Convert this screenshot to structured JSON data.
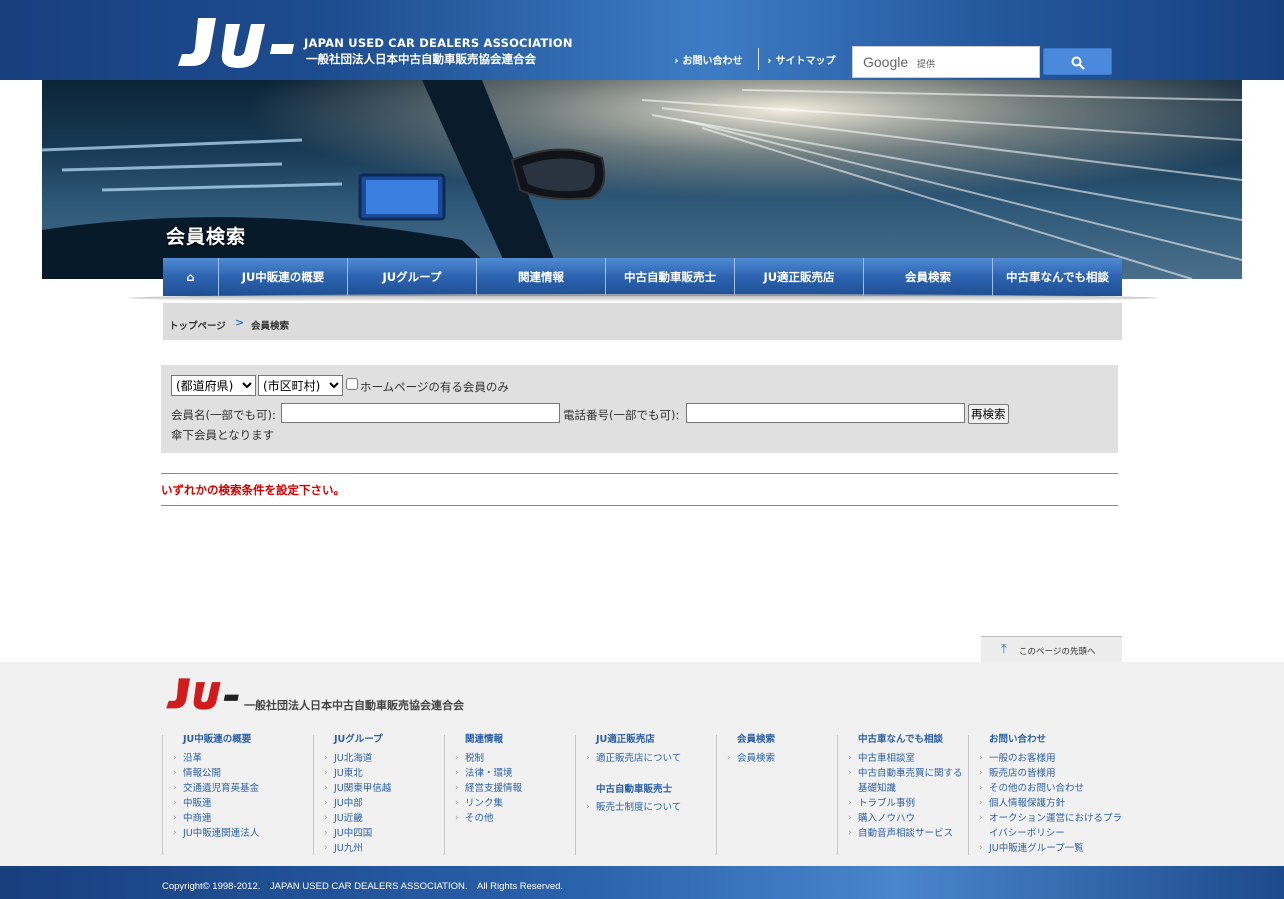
{
  "header": {
    "logo_text": "JU",
    "org_name_en": "JAPAN USED CAR DEALERS ASSOCIATION",
    "org_name_ja": "一般社団法人日本中古自動車販売協会連合会",
    "links": [
      {
        "label": "お問い合わせ"
      },
      {
        "label": "サイトマップ"
      }
    ],
    "search": {
      "brand": "Google",
      "provided_by": "提供",
      "value": ""
    }
  },
  "hero": {
    "page_title": "会員検索"
  },
  "nav": {
    "items": [
      {
        "label": "⌂"
      },
      {
        "label": "JU中販連の概要"
      },
      {
        "label": "JUグループ"
      },
      {
        "label": "関連情報"
      },
      {
        "label": "中古自動車販売士"
      },
      {
        "label": "JU適正販売店"
      },
      {
        "label": "会員検索"
      },
      {
        "label": "中古車なんでも相談"
      }
    ]
  },
  "breadcrumb": {
    "home": "トップページ",
    "separator": ">",
    "current": "会員検索"
  },
  "search_form": {
    "prefecture_selected": "(都道府県)",
    "city_selected": "(市区町村)",
    "homepage_only_label": "ホームページの有る会員のみ",
    "name_label": "会員名(一部でも可):",
    "name_value": "",
    "tel_label": "電話番号(一部でも可):",
    "tel_value": "",
    "research_button": "再検索",
    "note": "傘下会員となります"
  },
  "message": "いずれかの検索条件を設定下さい。",
  "page_top": "このページの先頭へ",
  "footer": {
    "org_name": "一般社団法人日本中古自動車販売協会連合会",
    "columns": [
      {
        "heading": "JU中販連の概要",
        "items": [
          "沿革",
          "情報公開",
          "交通遺児育英基金",
          "中販連",
          "中商連",
          "JU中販連関連法人"
        ]
      },
      {
        "heading": "JUグループ",
        "items": [
          "JU北海道",
          "JU東北",
          "JU関東甲信越",
          "JU中部",
          "JU近畿",
          "JU中四国",
          "JU九州"
        ]
      },
      {
        "heading": "関連情報",
        "items": [
          "税制",
          "法律・環境",
          "経営支援情報",
          "リンク集",
          "その他"
        ]
      },
      {
        "heading": "JU適正販売店",
        "items": [
          "適正販売店について"
        ],
        "heading2": "中古自動車販売士",
        "items2": [
          "販売士制度について"
        ]
      },
      {
        "heading": "会員検索",
        "items": [
          "会員検索"
        ]
      },
      {
        "heading": "中古車なんでも相談",
        "items": [
          "中古車相談室",
          "中古自動車売買に関する基礎知識",
          "トラブル事例",
          "購入ノウハウ",
          "自動音声相談サービス"
        ]
      },
      {
        "heading": "お問い合わせ",
        "items": [
          "一般のお客様用",
          "販売店の皆様用",
          "その他のお問い合わせ",
          "個人情報保護方針",
          "オークション運営におけるプライバシーポリシー",
          "JU中販連グループ一覧"
        ]
      }
    ],
    "copyright": "Copyright© 1998-2012.　JAPAN USED CAR DEALERS ASSOCIATION.　All Rights Reserved."
  }
}
